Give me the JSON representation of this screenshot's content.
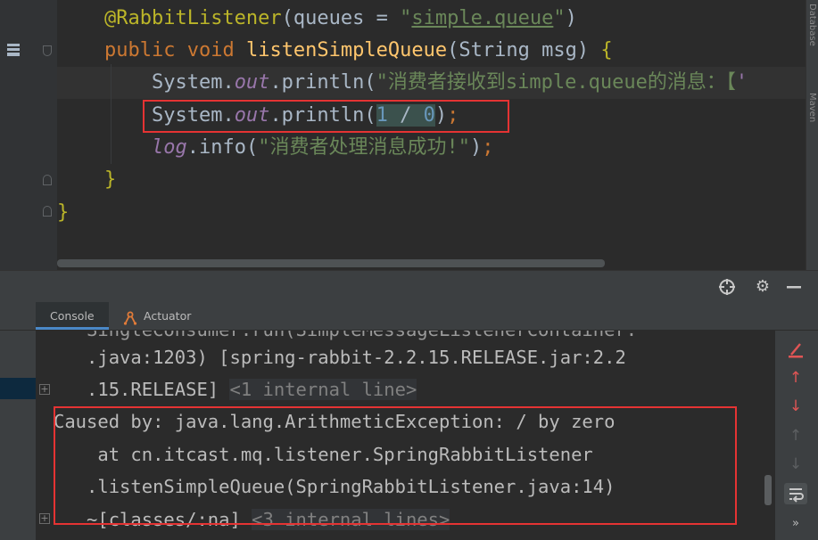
{
  "editor": {
    "line1": {
      "indent": "    ",
      "annotation": "@RabbitListener",
      "open": "(",
      "param": "queues",
      "eq": " = ",
      "q1": "\"",
      "value": "simple.queue",
      "q2": "\"",
      "close": ")"
    },
    "line2": {
      "indent": "    ",
      "kw_public": "public",
      "kw_void": " void ",
      "method": "listenSimpleQueue",
      "sig_open": "(String msg) ",
      "brace": "{"
    },
    "line3": {
      "indent": "        ",
      "cls": "System.",
      "field": "out",
      "call": ".println(",
      "str": "\"消费者接收到simple.queue的消息：【",
      "tail": "'"
    },
    "line4": {
      "indent": "        ",
      "cls": "System.",
      "field": "out",
      "call": ".println(",
      "n1": "1",
      "op": " / ",
      "n2": "0",
      "close": ")",
      "semi": ";"
    },
    "line5": {
      "indent": "        ",
      "field": "log",
      "call": ".info(",
      "str": "\"消费者处理消息成功!\"",
      "close": ")",
      "semi": ";"
    },
    "line6": {
      "indent": "    ",
      "brace": "}"
    },
    "line7": {
      "brace": "}"
    },
    "right_strip_labels": [
      "Database",
      "Maven"
    ]
  },
  "tool_window": {
    "tabs": [
      {
        "label": "Console"
      },
      {
        "label": "Actuator"
      }
    ]
  },
  "console": {
    "lines": [
      {
        "text": "   SingleConsumer.run(SimpleMessageListenerContainer."
      },
      {
        "text": "   .java:1203) [spring-rabbit-2.2.15.RELEASE.jar:2.2"
      },
      {
        "text": "   .15.RELEASE] ",
        "internal": "<1 internal line>"
      },
      {
        "text": "Caused by: java.lang.ArithmeticException: / by zero"
      },
      {
        "text": "    at cn.itcast.mq.listener.SpringRabbitListener"
      },
      {
        "text": "   .listenSimpleQueue(SpringRabbitListener.java:14)"
      },
      {
        "text": "   ~[classes/:na] ",
        "internal": "<3 internal lines>"
      }
    ]
  },
  "colors": {
    "editor_bg": "#2b2b2b",
    "highlight_border": "#e53333",
    "keyword": "#cc7832",
    "annotation": "#bbb529",
    "string": "#6a8759",
    "field": "#9876aa",
    "number": "#6897bb",
    "method": "#ffc66d"
  },
  "icons": {
    "header": [
      "crosshair-icon",
      "gear-icon",
      "minimize-icon"
    ],
    "console_side": [
      "clear-icon",
      "up-arrow-icon",
      "down-arrow-icon",
      "up-arrow-disabled-icon",
      "down-arrow-disabled-icon",
      "soft-wrap-icon",
      "more-icon"
    ]
  }
}
